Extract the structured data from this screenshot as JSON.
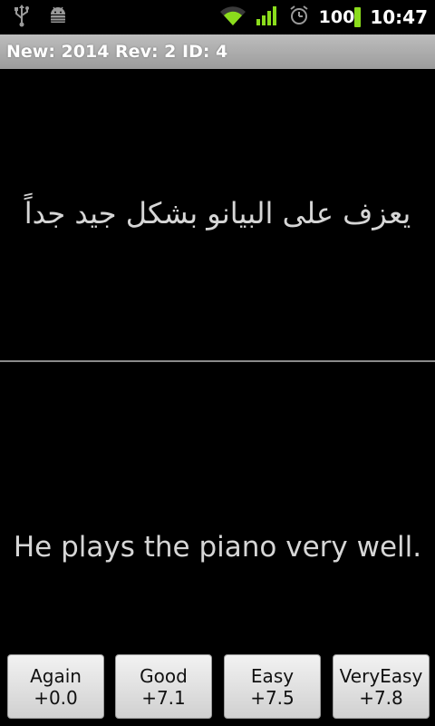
{
  "status_bar": {
    "left_icons": [
      "usb-icon",
      "android-debug-icon"
    ],
    "right_icons": [
      "wifi-icon",
      "signal-icon",
      "alarm-icon"
    ],
    "battery_level": "100",
    "time": "10:47",
    "colors": {
      "battery": "#8bdc1c",
      "signal": "#8bdc1c"
    }
  },
  "title_bar": {
    "title": "New: 2014 Rev: 2 ID: 4"
  },
  "card": {
    "question": "يعزف على البيانو بشكل جيد جداً",
    "answer": "He plays the piano very well."
  },
  "buttons": [
    {
      "label": "Again",
      "sub": "+0.0"
    },
    {
      "label": "Good",
      "sub": "+7.1"
    },
    {
      "label": "Easy",
      "sub": "+7.5"
    },
    {
      "label": "VeryEasy",
      "sub": "+7.8"
    }
  ]
}
